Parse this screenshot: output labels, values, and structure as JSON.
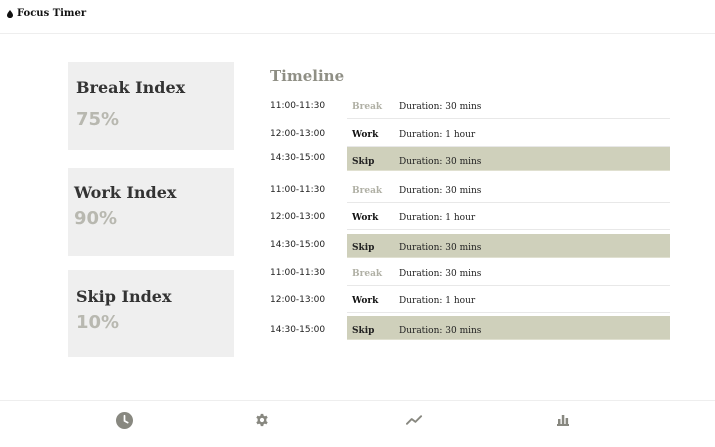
{
  "app": {
    "title": "Focus Timer",
    "icon": "water-drop-icon"
  },
  "cards": [
    {
      "title": "Break Index",
      "value": "75%"
    },
    {
      "title": "Work Index",
      "value": "90%"
    },
    {
      "title": "Skip Index",
      "value": "10%"
    }
  ],
  "timeline": {
    "title": "Timeline",
    "rows": [
      {
        "time": "11:00-11:30",
        "type": "Break",
        "duration": "Duration: 30 mins"
      },
      {
        "time": "12:00-13:00",
        "type": "Work",
        "duration": "Duration: 1 hour"
      },
      {
        "time": "14:30-15:00",
        "type": "Skip",
        "duration": "Duration: 30 mins"
      },
      {
        "time": "11:00-11:30",
        "type": "Break",
        "duration": "Duration: 30 mins"
      },
      {
        "time": "12:00-13:00",
        "type": "Work",
        "duration": "Duration: 1 hour"
      },
      {
        "time": "14:30-15:00",
        "type": "Skip",
        "duration": "Duration: 30 mins"
      },
      {
        "time": "11:00-11:30",
        "type": "Break",
        "duration": "Duration: 30 mins"
      },
      {
        "time": "12:00-13:00",
        "type": "Work",
        "duration": "Duration: 1 hour"
      },
      {
        "time": "14:30-15:00",
        "type": "Skip",
        "duration": "Duration: 30 mins"
      }
    ]
  },
  "nav": {
    "items": [
      {
        "icon": "clock-icon",
        "active": true
      },
      {
        "icon": "gear-icon",
        "active": false
      },
      {
        "icon": "trend-icon",
        "active": false
      },
      {
        "icon": "bar-chart-icon",
        "active": false
      }
    ]
  },
  "colors": {
    "skip_highlight": "#cfd0bb",
    "card_bg": "#efefef",
    "muted_value": "#b8b8b0",
    "timeline_title": "#8f8f85",
    "nav_icon": "#888880"
  }
}
